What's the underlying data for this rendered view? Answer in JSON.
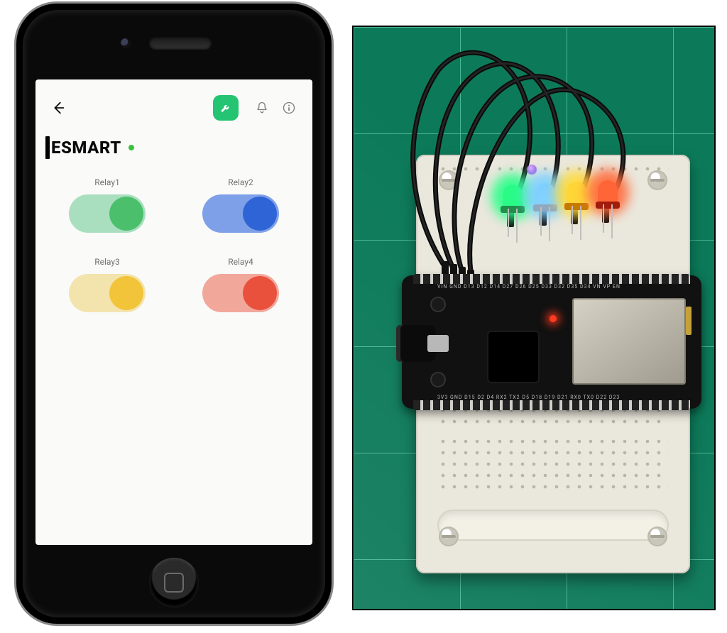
{
  "app": {
    "title": "ESMART",
    "status": "online"
  },
  "toolbar": {
    "back": "Back",
    "tools": "Tools",
    "notifications": "Notifications",
    "info": "Info"
  },
  "relays": [
    {
      "label": "Relay1",
      "state": "on",
      "color": "green"
    },
    {
      "label": "Relay2",
      "state": "on",
      "color": "blue"
    },
    {
      "label": "Relay3",
      "state": "on",
      "color": "yellow"
    },
    {
      "label": "Relay4",
      "state": "on",
      "color": "red"
    }
  ],
  "hardware": {
    "board": "ESP32 DevKit",
    "leds": [
      {
        "color": "green",
        "lit": true
      },
      {
        "color": "blue",
        "lit": true
      },
      {
        "color": "yellow",
        "lit": true
      },
      {
        "color": "red",
        "lit": true
      }
    ],
    "mat": "green cutting mat",
    "pin_row_top": "VIN GND D13 D12 D14 D27 D26 D25 D33 D32 D35 D34 VN VP EN",
    "pin_row_bottom": "3V3 GND D15 D2 D4 RX2 TX2 D5 D18 D19 D21 RX0 TX0 D22 D23",
    "buttons": {
      "en": "EN",
      "boot": "BOOT"
    }
  }
}
